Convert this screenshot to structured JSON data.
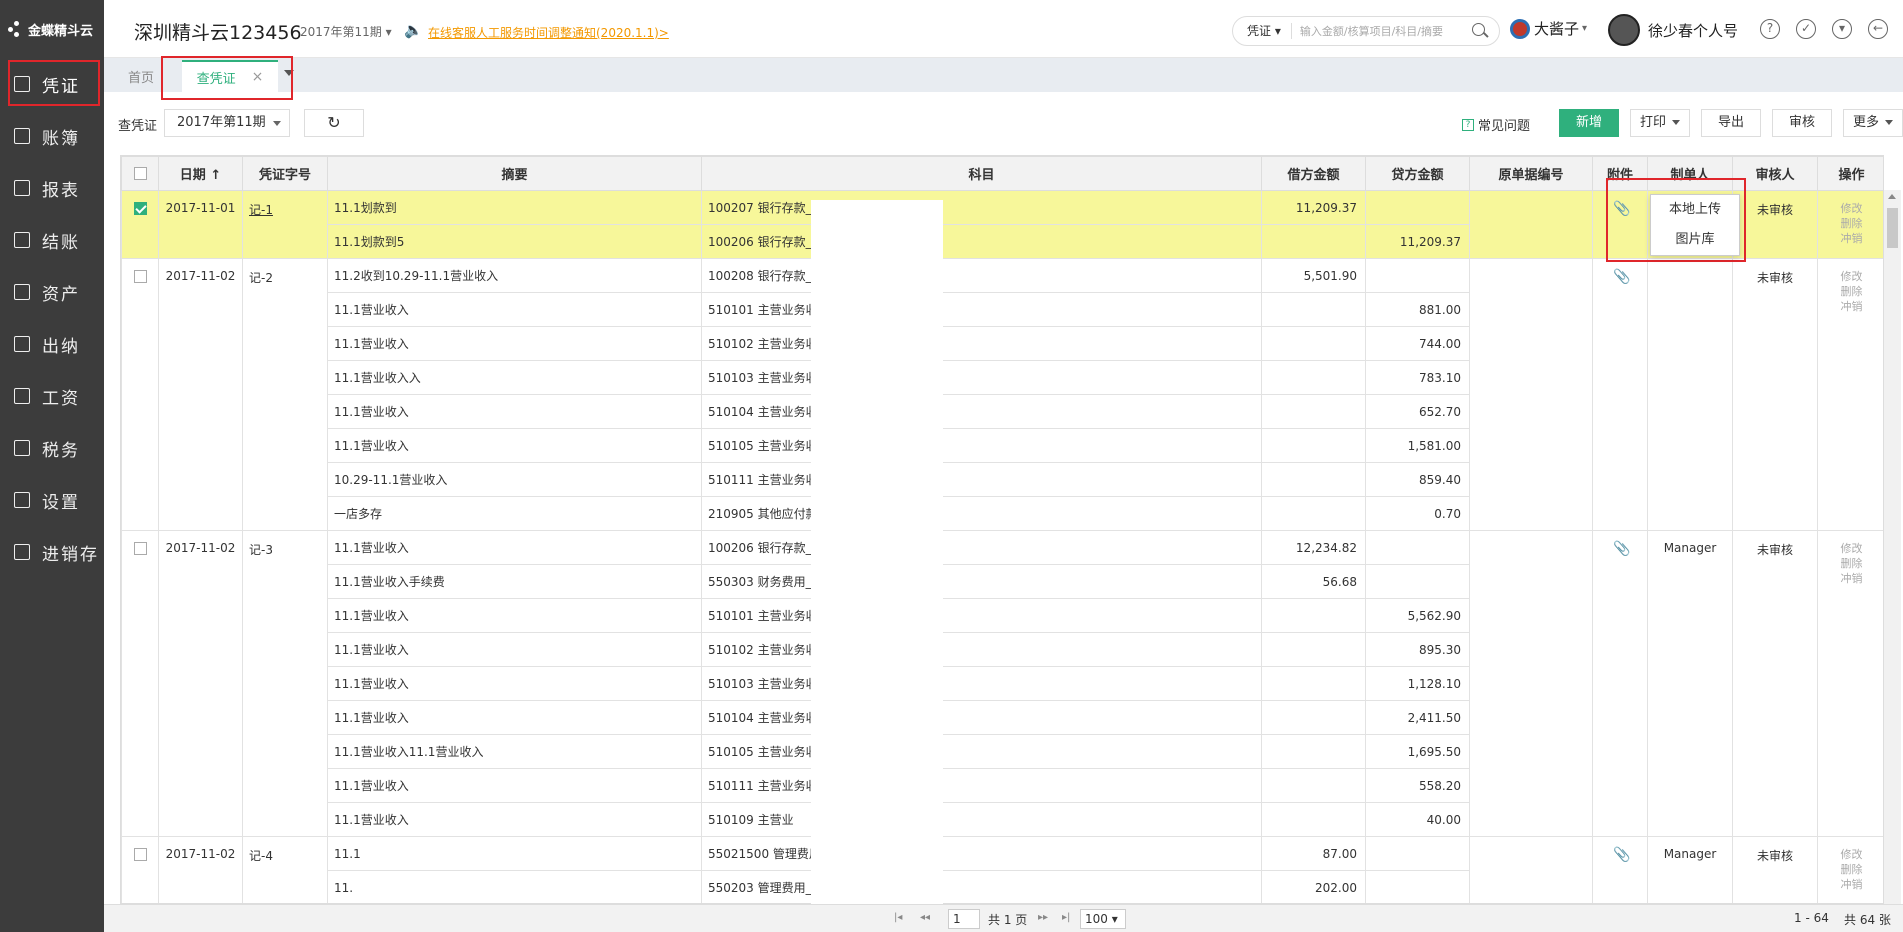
{
  "sidebar": {
    "logo": "金蝶精斗云",
    "items": [
      {
        "label": "凭证",
        "icon": "voucher-icon",
        "active": true
      },
      {
        "label": "账簿",
        "icon": "ledger-icon"
      },
      {
        "label": "报表",
        "icon": "report-icon"
      },
      {
        "label": "结账",
        "icon": "checkout-icon"
      },
      {
        "label": "资产",
        "icon": "asset-icon"
      },
      {
        "label": "出纳",
        "icon": "cashier-icon"
      },
      {
        "label": "工资",
        "icon": "salary-icon"
      },
      {
        "label": "税务",
        "icon": "tax-icon"
      },
      {
        "label": "设置",
        "icon": "settings-icon"
      },
      {
        "label": "进销存",
        "icon": "inventory-icon"
      }
    ]
  },
  "header": {
    "company": "深圳精斗云123456",
    "period": "2017年第11期",
    "notice": "在线客服人工服务时间调整通知(2020.1.1)>",
    "search_type": "凭证",
    "search_placeholder": "输入金额/核算项目/科目/摘要",
    "user1": "大酱子",
    "user2": "徐少春个人号"
  },
  "tabs": {
    "home": "首页",
    "current": "查凭证"
  },
  "toolbar": {
    "label": "查凭证",
    "period": "2017年第11期",
    "faq": "常见问题",
    "add": "新增",
    "print": "打印",
    "export": "导出",
    "audit": "审核",
    "more": "更多"
  },
  "table": {
    "headers": [
      "日期",
      "凭证字号",
      "摘要",
      "科目",
      "借方金额",
      "贷方金额",
      "原单据编号",
      "附件",
      "制单人",
      "审核人",
      "操作"
    ],
    "sort_indicator": "↑",
    "vouchers": [
      {
        "date": "2017-11-01",
        "no": "记-1",
        "checked": true,
        "maker": "",
        "auditor": "未审核",
        "lines": [
          {
            "summary": "11.1划款到",
            "account": "100207 银行存款_",
            "debit": "11,209.37",
            "credit": ""
          },
          {
            "summary": "11.1划款到5",
            "account": "100206 银行存款_",
            "debit": "",
            "credit": "11,209.37"
          }
        ]
      },
      {
        "date": "2017-11-02",
        "no": "记-2",
        "checked": false,
        "maker": "",
        "auditor": "未审核",
        "lines": [
          {
            "summary": "11.2收到10.29-11.1营业收入",
            "account": "100208 银行存款_",
            "debit": "5,501.90",
            "credit": ""
          },
          {
            "summary": "11.1营业收入",
            "account": "510101 主营业务收",
            "debit": "",
            "credit": "881.00"
          },
          {
            "summary": "11.1营业收入",
            "account": "510102 主营业务收",
            "debit": "",
            "credit": "744.00"
          },
          {
            "summary": "11.1营业收入入",
            "account": "510103 主营业务收",
            "debit": "",
            "credit": "783.10"
          },
          {
            "summary": "11.1营业收入",
            "account": "510104 主营业务收",
            "debit": "",
            "credit": "652.70"
          },
          {
            "summary": "11.1营业收入",
            "account": "510105 主营业务收",
            "debit": "",
            "credit": "1,581.00"
          },
          {
            "summary": "10.29-11.1营业收入",
            "account": "510111 主营业务收",
            "debit": "",
            "credit": "859.40"
          },
          {
            "summary": "一店多存",
            "account": "210905 其他应付款",
            "debit": "",
            "credit": "0.70"
          }
        ]
      },
      {
        "date": "2017-11-02",
        "no": "记-3",
        "checked": false,
        "maker": "Manager",
        "auditor": "未审核",
        "lines": [
          {
            "summary": "11.1营业收入",
            "account": "100206 银行存款_",
            "debit": "12,234.82",
            "credit": ""
          },
          {
            "summary": "11.1营业收入手续费",
            "account": "550303 财务费用_",
            "debit": "56.68",
            "credit": ""
          },
          {
            "summary": "11.1营业收入",
            "account": "510101 主营业务收",
            "debit": "",
            "credit": "5,562.90"
          },
          {
            "summary": "11.1营业收入",
            "account": "510102 主营业务收",
            "debit": "",
            "credit": "895.30"
          },
          {
            "summary": "11.1营业收入",
            "account": "510103 主营业务收",
            "debit": "",
            "credit": "1,128.10"
          },
          {
            "summary": "11.1营业收入",
            "account": "510104 主营业务收",
            "debit": "",
            "credit": "2,411.50"
          },
          {
            "summary": "11.1营业收入11.1营业收入",
            "account": "510105 主营业务收",
            "debit": "",
            "credit": "1,695.50"
          },
          {
            "summary": "11.1营业收入",
            "account": "510111 主营业务收",
            "debit": "",
            "credit": "558.20"
          },
          {
            "summary": "11.1营业收入",
            "account": "510109 主营业",
            "debit": "",
            "credit": "40.00"
          }
        ]
      },
      {
        "date": "2017-11-02",
        "no": "记-4",
        "checked": false,
        "maker": "Manager",
        "auditor": "未审核",
        "lines": [
          {
            "summary": "11.1",
            "account": "55021500 管理费用",
            "debit": "87.00",
            "credit": ""
          },
          {
            "summary": "11.",
            "account": "550203 管理费用_",
            "debit": "202.00",
            "credit": ""
          }
        ]
      }
    ],
    "ops": [
      "修改",
      "删除",
      "冲销"
    ]
  },
  "popup": {
    "items": [
      "本地上传",
      "图片库"
    ]
  },
  "pager": {
    "page": "1",
    "total_pages": "共 1 页",
    "page_size": "100",
    "range": "1 - 64",
    "total": "共 64 张"
  },
  "colors": {
    "accent": "#2fb07d",
    "highlight": "#f7f79a",
    "annotation": "#e0262b",
    "sidebar": "#3c3c3c"
  }
}
